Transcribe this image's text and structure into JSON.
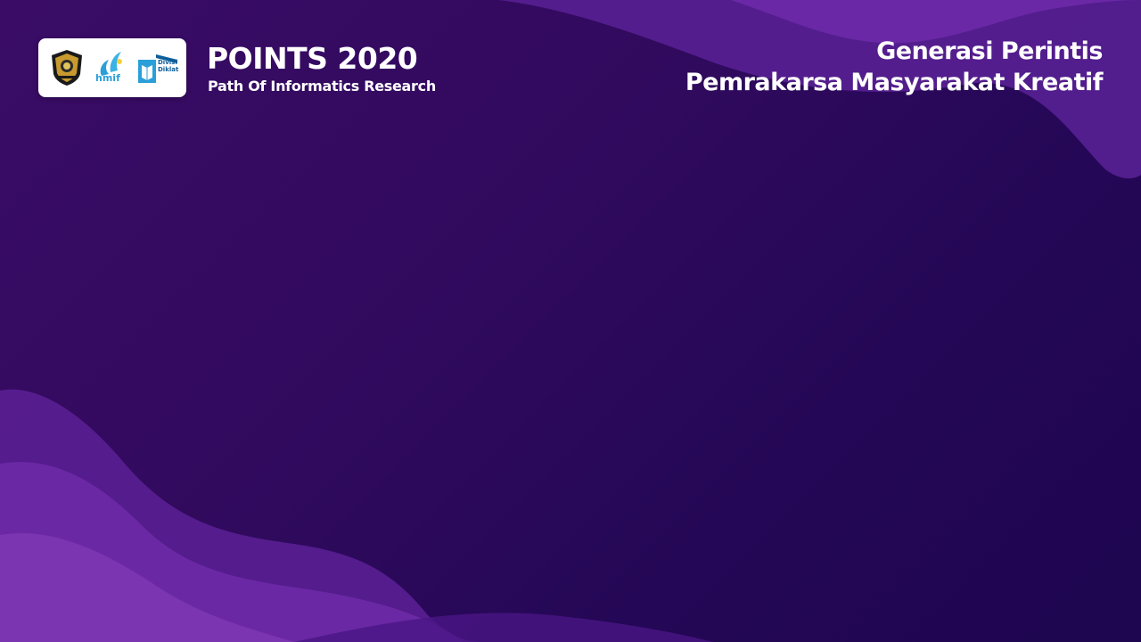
{
  "header": {
    "event_title": "POINTS 2020",
    "event_subtitle": "Path Of Informatics Research",
    "tagline_line1": "Generasi Perintis",
    "tagline_line2": "Pemrakarsa Masyarakat Kreatif"
  },
  "logos": {
    "hmif_label": "hmif",
    "diklat_label_line1": "Divisi",
    "diklat_label_line2": "Diklat"
  },
  "colors": {
    "background_dark": "#240756",
    "wave_light": "#7a35b0",
    "wave_mid": "#5a1e93",
    "text": "#ffffff",
    "hmif_blue": "#2a9fd8",
    "diklat_blue": "#0d5f9a"
  }
}
